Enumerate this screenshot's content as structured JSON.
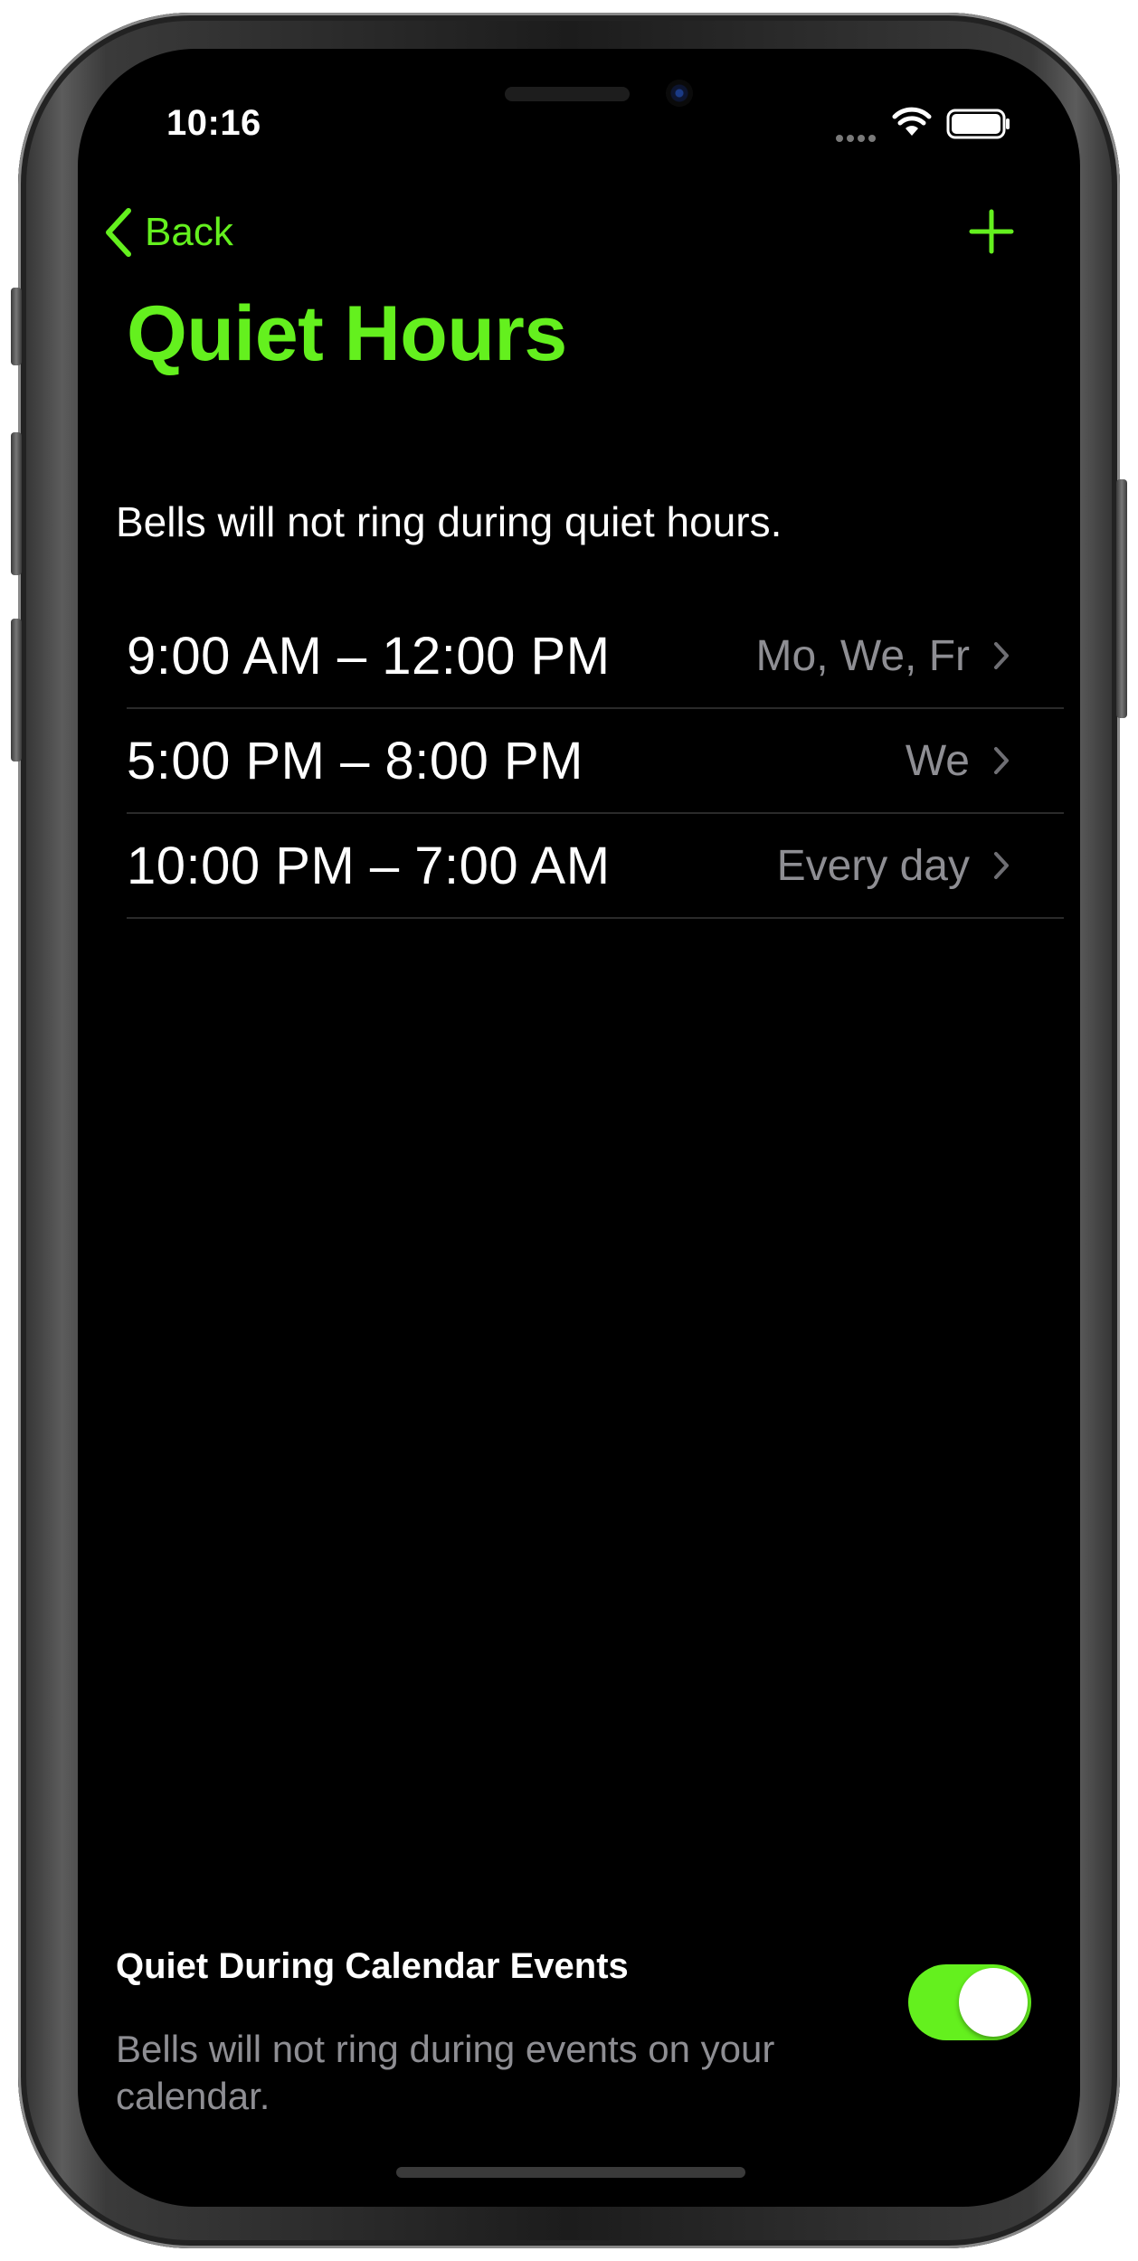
{
  "status_bar": {
    "time": "10:16"
  },
  "nav": {
    "back_label": "Back",
    "title": "Quiet Hours",
    "accent_color": "#64f01e"
  },
  "intro": "Bells will not ring during quiet hours.",
  "schedules": [
    {
      "time": "9:00 AM – 12:00 PM",
      "days": "Mo, We, Fr"
    },
    {
      "time": "5:00 PM – 8:00 PM",
      "days": "We"
    },
    {
      "time": "10:00 PM – 7:00 AM",
      "days": "Every day"
    }
  ],
  "calendar_events": {
    "title": "Quiet During Calendar Events",
    "description": "Bells will not ring during events on your calendar.",
    "toggle_on": true
  },
  "icons": {
    "back": "chevron-left-icon",
    "add": "plus-icon",
    "row_disclosure": "chevron-right-icon",
    "wifi": "wifi-icon",
    "battery": "battery-icon",
    "signal": "signal-dots-icon"
  }
}
